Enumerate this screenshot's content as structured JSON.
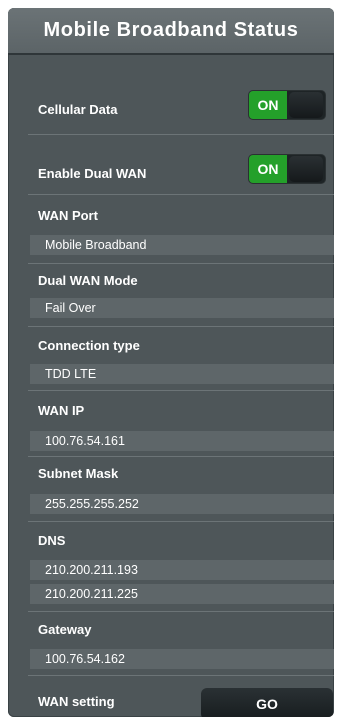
{
  "header": {
    "title": "Mobile Broadband Status"
  },
  "cellular_data": {
    "label": "Cellular Data",
    "state": "ON"
  },
  "dual_wan": {
    "label": "Enable Dual WAN",
    "state": "ON"
  },
  "wan_port": {
    "label": "WAN Port",
    "value": "Mobile Broadband"
  },
  "dual_wan_mode": {
    "label": "Dual WAN Mode",
    "value": "Fail Over"
  },
  "connection_type": {
    "label": "Connection type",
    "value": "TDD LTE"
  },
  "wan_ip": {
    "label": "WAN IP",
    "value": "100.76.54.161"
  },
  "subnet_mask": {
    "label": "Subnet Mask",
    "value": "255.255.255.252"
  },
  "dns": {
    "label": "DNS",
    "values": [
      "210.200.211.193",
      "210.200.211.225"
    ]
  },
  "gateway": {
    "label": "Gateway",
    "value": "100.76.54.162"
  },
  "wan_setting": {
    "label": "WAN setting",
    "button": "GO"
  },
  "colors": {
    "toggle_on": "#24a02a",
    "panel": "#4e5659",
    "value_row": "#5e6669"
  }
}
